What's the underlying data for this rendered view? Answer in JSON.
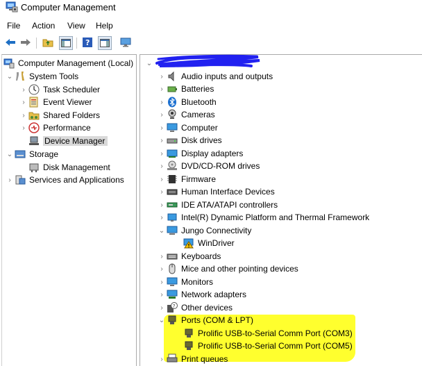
{
  "window": {
    "title": "Computer Management"
  },
  "menu": [
    {
      "id": "file",
      "label": "File"
    },
    {
      "id": "action",
      "label": "Action"
    },
    {
      "id": "view",
      "label": "View"
    },
    {
      "id": "help",
      "label": "Help"
    }
  ],
  "toolbar": {
    "icons": [
      "back-arrow-icon",
      "forward-arrow-icon",
      "up-folder-icon",
      "show-hide-tree-icon",
      "help-icon",
      "properties-icon",
      "monitor-icon"
    ]
  },
  "left_tree": {
    "root": "Computer Management (Local)",
    "system_tools": "System Tools",
    "task_scheduler": "Task Scheduler",
    "event_viewer": "Event Viewer",
    "shared_folders": "Shared Folders",
    "performance": "Performance",
    "device_manager": "Device Manager",
    "storage": "Storage",
    "disk_management": "Disk Management",
    "services_apps": "Services and Applications"
  },
  "device_tree": {
    "computer_name_redacted": true,
    "audio": "Audio inputs and outputs",
    "batteries": "Batteries",
    "bluetooth": "Bluetooth",
    "cameras": "Cameras",
    "computer": "Computer",
    "disk_drives": "Disk drives",
    "display": "Display adapters",
    "dvd": "DVD/CD-ROM drives",
    "firmware": "Firmware",
    "hid": "Human Interface Devices",
    "ide": "IDE ATA/ATAPI controllers",
    "intel": "Intel(R) Dynamic Platform and Thermal Framework",
    "jungo": "Jungo Connectivity",
    "windriver": "WinDriver",
    "keyboards": "Keyboards",
    "mice": "Mice and other pointing devices",
    "monitors": "Monitors",
    "network": "Network adapters",
    "other": "Other devices",
    "ports": "Ports (COM & LPT)",
    "com3": "Prolific USB-to-Serial Comm Port (COM3)",
    "com5": "Prolific USB-to-Serial Comm Port (COM5)",
    "print_queues": "Print queues"
  },
  "colors": {
    "highlight": "#ffff2e",
    "scribble": "#2121f0",
    "selection": "#d9d9d9",
    "nav_arrow": "#1e6fc4"
  }
}
